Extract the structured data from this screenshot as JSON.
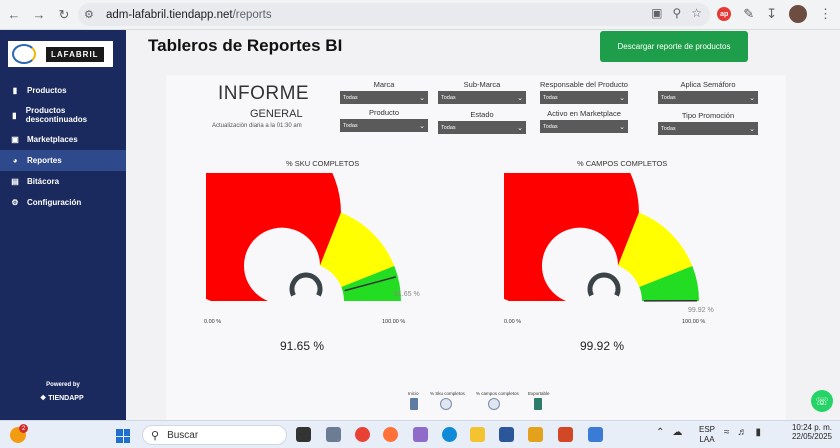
{
  "browser": {
    "url_domain": "adm-lafabril.tiendapp.net",
    "url_path": "/reports"
  },
  "sidebar": {
    "logo_text": "LAFABRIL",
    "items": [
      {
        "label": "Productos",
        "icon": "bookmark-icon"
      },
      {
        "label": "Productos descontinuados",
        "icon": "bookmark-icon"
      },
      {
        "label": "Marketplaces",
        "icon": "briefcase-icon"
      },
      {
        "label": "Reportes",
        "icon": "pie-chart-icon",
        "active": true
      },
      {
        "label": "Bitácora",
        "icon": "chart-icon"
      },
      {
        "label": "Configuración",
        "icon": "gears-icon"
      }
    ],
    "powered_by": "Powered by",
    "brand": "TIENDAPP"
  },
  "main": {
    "title": "Tableros de Reportes BI",
    "download_button": "Descargar reporte de productos"
  },
  "report": {
    "title": "INFORME",
    "subtitle": "GENERAL",
    "update_note": "Actualización diaria a la 01:30 am",
    "filters": [
      {
        "label": "Marca",
        "value": "Todas"
      },
      {
        "label": "Sub-Marca",
        "value": "Todas"
      },
      {
        "label": "Responsable del Producto",
        "value": "Todas"
      },
      {
        "label": "Aplica Semáforo",
        "value": "Todas"
      },
      {
        "label": "Producto",
        "value": "Todas"
      },
      {
        "label": "Estado",
        "value": "Todas"
      },
      {
        "label": "Activo en Marketplace",
        "value": "Todas"
      },
      {
        "label": "Tipo Promoción",
        "value": "Todas"
      }
    ],
    "gauges": [
      {
        "title": "% SKU COMPLETOS",
        "value": 91.65,
        "value_label": "91.65 %",
        "big_label": "91.65 %",
        "min_label": "0.00 %",
        "max_label": "100.00 %"
      },
      {
        "title": "% CAMPOS COMPLETOS",
        "value": 99.92,
        "value_label": "99.92 %",
        "big_label": "99.92 %",
        "min_label": "0.00 %",
        "max_label": "100.00 %"
      }
    ],
    "zone_colors": {
      "red": "#ff0000",
      "yellow": "#ffff00",
      "green": "#22dd22"
    },
    "pages": [
      {
        "label": "Inicio"
      },
      {
        "label": "% Sku completos"
      },
      {
        "label": "% campos completos"
      },
      {
        "label": "Exportable"
      }
    ]
  },
  "taskbar": {
    "notification_count": "2",
    "search_placeholder": "Buscar",
    "lang_line1": "ESP",
    "lang_line2": "LAA",
    "time": "10:24 p. m.",
    "date": "22/05/2025"
  }
}
